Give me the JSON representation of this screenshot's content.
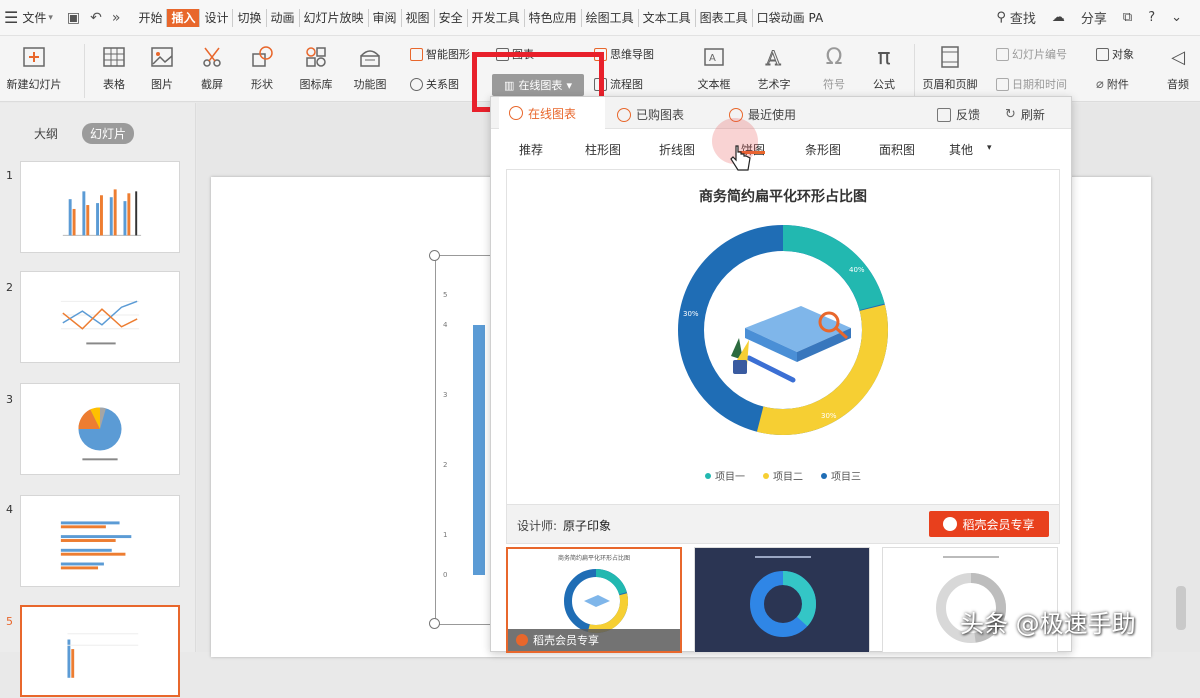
{
  "menu": {
    "file": "文件",
    "tabs": [
      "开始",
      "插入",
      "设计",
      "切换",
      "动画",
      "幻灯片放映",
      "审阅",
      "视图",
      "安全",
      "开发工具",
      "特色应用",
      "绘图工具",
      "文本工具",
      "图表工具",
      "口袋动画 PA"
    ],
    "active_tab": "插入",
    "search": "查找",
    "share": "分享",
    "help": "?"
  },
  "ribbon": {
    "new_slide": "新建幻灯片",
    "table": "表格",
    "picture": "图片",
    "screenshot": "截屏",
    "shape": "形状",
    "icon_lib": "图标库",
    "function_chart": "功能图",
    "smart_graphic": "智能图形",
    "chart": "图表",
    "relation_chart": "关系图",
    "online_chart": "在线图表",
    "mind_map": "思维导图",
    "flowchart": "流程图",
    "textbox": "文本框",
    "art_text": "艺术字",
    "symbol": "符号",
    "formula": "公式",
    "header_footer": "页眉和页脚",
    "slide_number": "幻灯片编号",
    "date_time": "日期和时间",
    "object": "对象",
    "attachment": "附件",
    "audio": "音频"
  },
  "left_pane": {
    "tab_outline": "大纲",
    "tab_slides": "幻灯片",
    "slide_numbers": [
      "1",
      "2",
      "3",
      "4",
      "5"
    ]
  },
  "popup": {
    "tab_online": "在线图表",
    "tab_purchased": "已购图表",
    "tab_recent": "最近使用",
    "feedback": "反馈",
    "refresh": "刷新",
    "categories": [
      "推荐",
      "柱形图",
      "折线图",
      "饼图",
      "条形图",
      "面积图",
      "其他"
    ],
    "more_arrow": "▾",
    "preview_title": "商务简约扁平化环形占比图",
    "legend": [
      "项目一",
      "项目二",
      "项目三"
    ],
    "ring_labels": [
      "40%",
      "30%",
      "30%"
    ],
    "designer_label": "设计师:",
    "designer_name": "原子印象",
    "vip_button": "稻壳会员专享",
    "template_label": "稻壳会员专享",
    "template_title": "商务简约扁平化环形占比图"
  },
  "chart_axis": [
    "5",
    "4",
    "3",
    "2",
    "1",
    "0"
  ],
  "watermark": "头条 @极速手助",
  "colors": {
    "accent": "#e8672c",
    "highlight_box": "#e8202b",
    "ring_blue": "#1f6db5",
    "ring_teal": "#22b8b0",
    "ring_yellow": "#f6cf33"
  }
}
